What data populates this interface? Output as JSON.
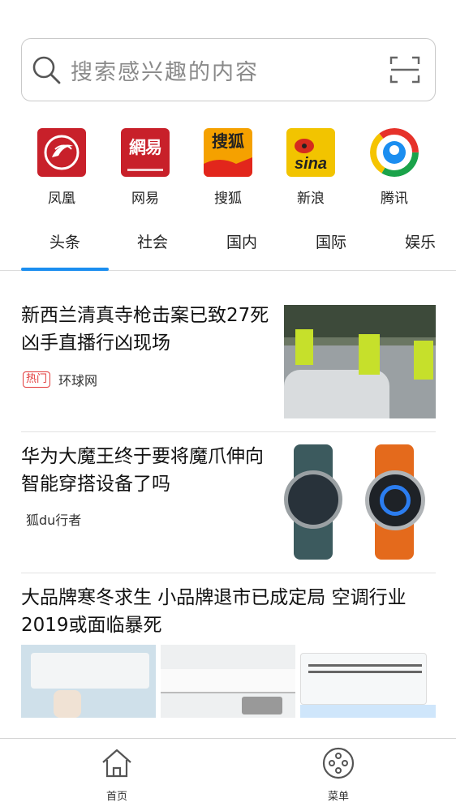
{
  "search": {
    "placeholder": "搜索感兴趣的内容",
    "icon": "search-icon",
    "scan_icon": "scan-icon"
  },
  "shortcuts": [
    {
      "label": "凤凰",
      "icon": "ifeng-logo",
      "color": "#c8202a"
    },
    {
      "label": "网易",
      "icon": "netease-logo",
      "color": "#c8202a"
    },
    {
      "label": "搜狐",
      "icon": "sohu-logo",
      "color": "#f5a100"
    },
    {
      "label": "新浪",
      "icon": "sina-logo",
      "color": "#f2c400"
    },
    {
      "label": "腾讯",
      "icon": "tencent-logo",
      "color": "#1aa34a"
    }
  ],
  "tabs": [
    "头条",
    "社会",
    "国内",
    "国际",
    "娱乐"
  ],
  "active_tab": "头条",
  "accent": "#1b8ef0",
  "news": [
    {
      "title": "新西兰清真寺枪击案已致27死 凶手直播行凶现场",
      "hot": "热门",
      "source": "环球网"
    },
    {
      "title": "华为大魔王终于要将魔爪伸向智能穿搭设备了吗",
      "source": "狐du行者"
    },
    {
      "title": "大品牌寒冬求生 小品牌退市已成定局 空调行业2019或面临暴死"
    }
  ],
  "bottom_nav": [
    {
      "label": "首页",
      "icon": "home-icon"
    },
    {
      "label": "菜单",
      "icon": "menu-icon"
    }
  ]
}
